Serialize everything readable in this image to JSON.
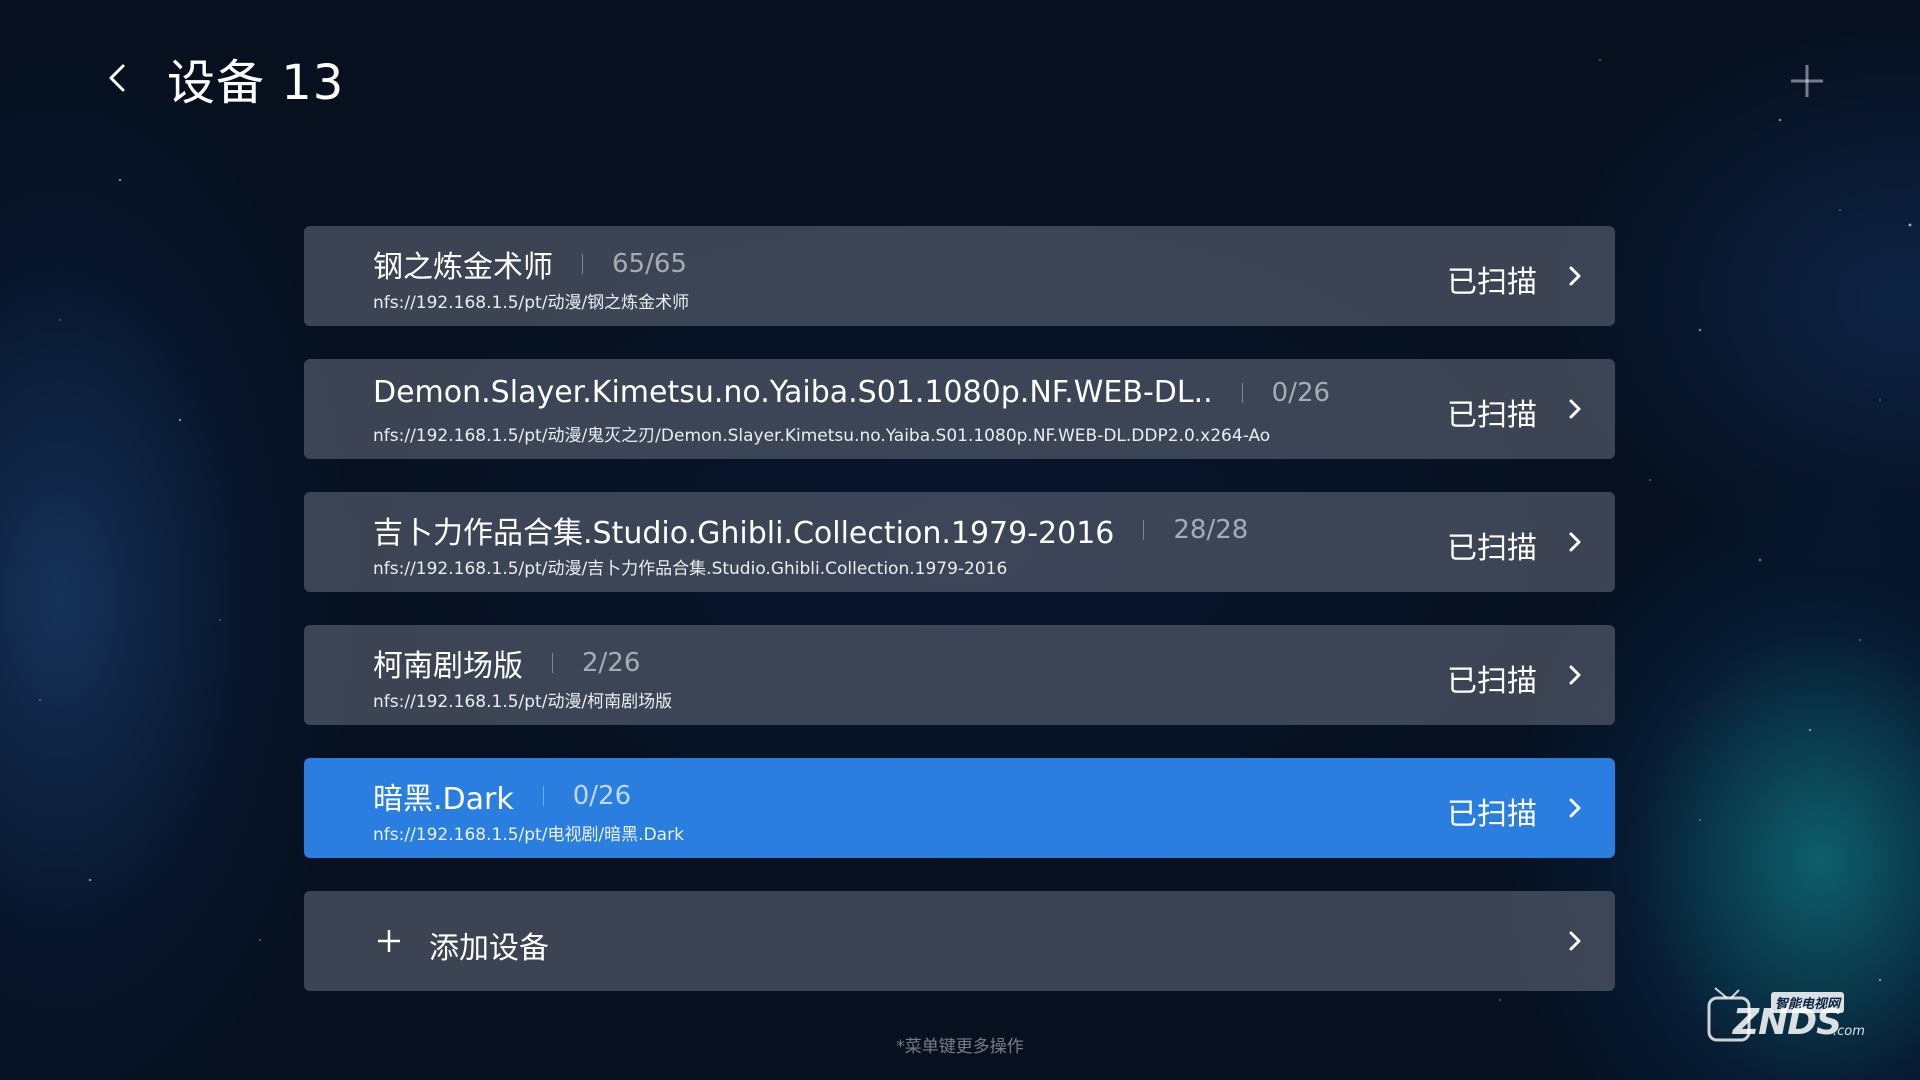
{
  "header": {
    "title": "设备 13",
    "back_icon": "chevron-left-icon",
    "add_icon": "plus-icon"
  },
  "devices": [
    {
      "name": "钢之炼金术师",
      "count": "65/65",
      "path": "nfs://192.168.1.5/pt/动漫/钢之炼金术师",
      "status": "已扫描",
      "selected": false
    },
    {
      "name": "Demon.Slayer.Kimetsu.no.Yaiba.S01.1080p.NF.WEB-DL..",
      "count": "0/26",
      "path": "nfs://192.168.1.5/pt/动漫/鬼灭之刃/Demon.Slayer.Kimetsu.no.Yaiba.S01.1080p.NF.WEB-DL.DDP2.0.x264-Ao",
      "status": "已扫描",
      "selected": false
    },
    {
      "name": "吉卜力作品合集.Studio.Ghibli.Collection.1979-2016",
      "count": "28/28",
      "path": "nfs://192.168.1.5/pt/动漫/吉卜力作品合集.Studio.Ghibli.Collection.1979-2016",
      "status": "已扫描",
      "selected": false
    },
    {
      "name": "柯南剧场版",
      "count": "2/26",
      "path": "nfs://192.168.1.5/pt/动漫/柯南剧场版",
      "status": "已扫描",
      "selected": false
    },
    {
      "name": "暗黑.Dark",
      "count": "0/26",
      "path": "nfs://192.168.1.5/pt/电视剧/暗黑.Dark",
      "status": "已扫描",
      "selected": true
    }
  ],
  "add_device": {
    "label": "添加设备"
  },
  "hint": "*菜单键更多操作",
  "watermark": {
    "brand": "ZNDS",
    "suffix": ".com",
    "tag": "智能电视网"
  },
  "colors": {
    "selected": "#2a7ee0",
    "row_bg": "#485060"
  }
}
